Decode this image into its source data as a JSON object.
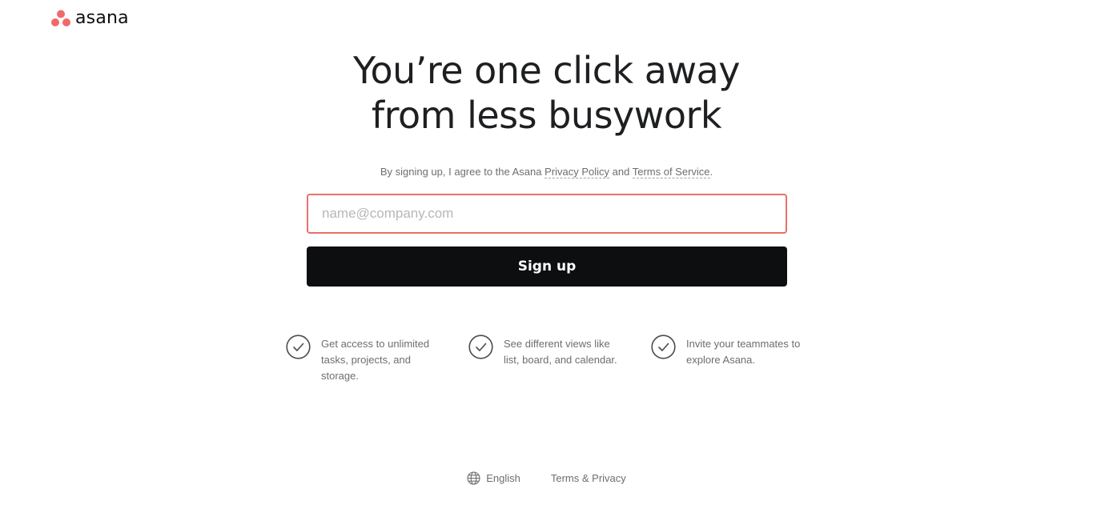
{
  "brand": {
    "name": "asana",
    "dot_color": "#f06a6a"
  },
  "hero": {
    "line1": "You’re one click away",
    "line2": "from less busywork"
  },
  "consent": {
    "prefix": "By signing up, I agree to the Asana ",
    "privacy_link": "Privacy Policy",
    "middle": " and ",
    "terms_link": "Terms of Service",
    "suffix": "."
  },
  "form": {
    "email_placeholder": "name@company.com",
    "email_value": "",
    "submit_label": "Sign up",
    "input_border_color": "#e8706a"
  },
  "features": [
    {
      "icon": "check-circle-icon",
      "text": "Get access to unlimited tasks, projects, and storage."
    },
    {
      "icon": "check-circle-icon",
      "text": "See different views like list, board, and calendar."
    },
    {
      "icon": "check-circle-icon",
      "text": "Invite your teammates to explore Asana."
    }
  ],
  "footer": {
    "language_icon": "globe-icon",
    "language": "English",
    "terms": "Terms & Privacy"
  }
}
